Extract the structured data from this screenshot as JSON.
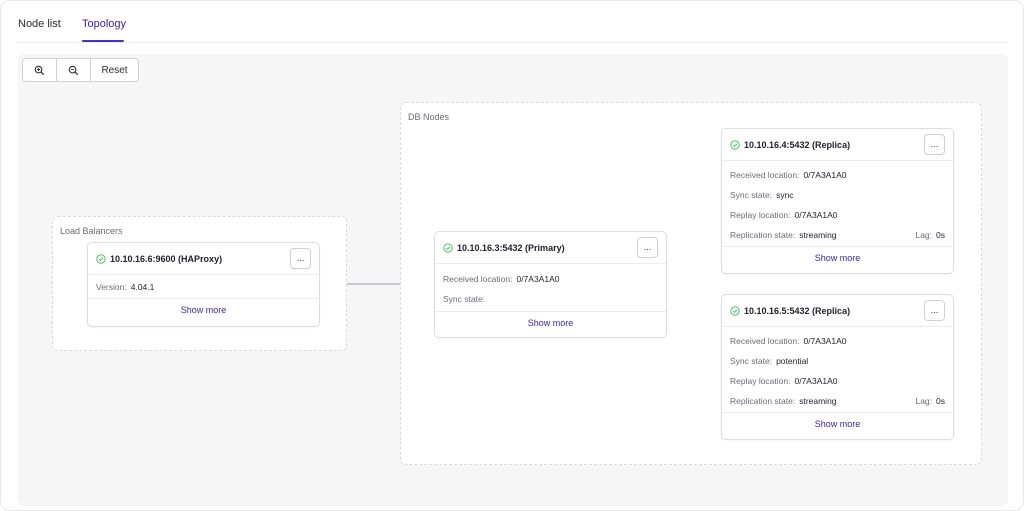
{
  "tabs": [
    {
      "label": "Node list"
    },
    {
      "label": "Topology"
    }
  ],
  "toolbar": {
    "zoom_in_icon": "zoom-in-icon",
    "zoom_out_icon": "zoom-out-icon",
    "reset_label": "Reset"
  },
  "load_balancers": {
    "label": "Load Balancers",
    "node": {
      "title": "10.10.16.6:9600 (HAProxy)",
      "menu_label": "...",
      "version_key": "Version:",
      "version_value": "4.04.1",
      "show_more": "Show more"
    }
  },
  "db_nodes": {
    "label": "DB Nodes",
    "primary": {
      "title": "10.10.16.3:5432 (Primary)",
      "menu_label": "...",
      "received_key": "Received location:",
      "received_value": "0/7A3A1A0",
      "sync_key": "Sync state:",
      "sync_value": "",
      "show_more": "Show more"
    },
    "replica1": {
      "title": "10.10.16.4:5432 (Replica)",
      "menu_label": "...",
      "received_key": "Received location:",
      "received_value": "0/7A3A1A0",
      "sync_key": "Sync state:",
      "sync_value": "sync",
      "replay_key": "Replay location:",
      "replay_value": "0/7A3A1A0",
      "replication_key": "Replication state:",
      "replication_value": "streaming",
      "lag_key": "Lag:",
      "lag_value": "0s",
      "show_more": "Show more"
    },
    "replica2": {
      "title": "10.10.16.5:5432 (Replica)",
      "menu_label": "...",
      "received_key": "Received location:",
      "received_value": "0/7A3A1A0",
      "sync_key": "Sync state:",
      "sync_value": "potential",
      "replay_key": "Replay location:",
      "replay_value": "0/7A3A1A0",
      "replication_key": "Replication state:",
      "replication_value": "streaming",
      "lag_key": "Lag:",
      "lag_value": "0s",
      "show_more": "Show more"
    }
  },
  "colors": {
    "accent": "#4b2bc9",
    "ok": "#3fb950",
    "edge": "#9a9aa6"
  }
}
